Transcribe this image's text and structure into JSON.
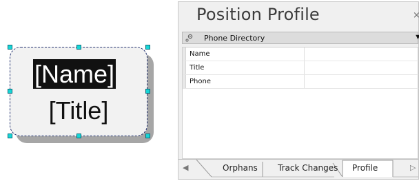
{
  "shape": {
    "name_field": "[Name]",
    "title_field": "[Title]"
  },
  "pane": {
    "title": "Position Profile",
    "close_glyph": "×",
    "directory": {
      "icon": "gear-icon",
      "label": "Phone Directory",
      "arrow": "▼"
    },
    "fields": [
      {
        "label": "Name",
        "value": ""
      },
      {
        "label": "Title",
        "value": ""
      },
      {
        "label": "Phone",
        "value": ""
      }
    ],
    "tabs": [
      {
        "label": "Orphans",
        "active": false
      },
      {
        "label": "Track Changes",
        "active": false
      },
      {
        "label": "Profile",
        "active": true
      }
    ],
    "scroll_left": "◀",
    "scroll_right": "▷"
  },
  "colors": {
    "handle": "#17d6d6",
    "selection_text_bg": "#111111",
    "shape_fill": "#f2f2f2",
    "shape_border": "#1f2f6e"
  }
}
